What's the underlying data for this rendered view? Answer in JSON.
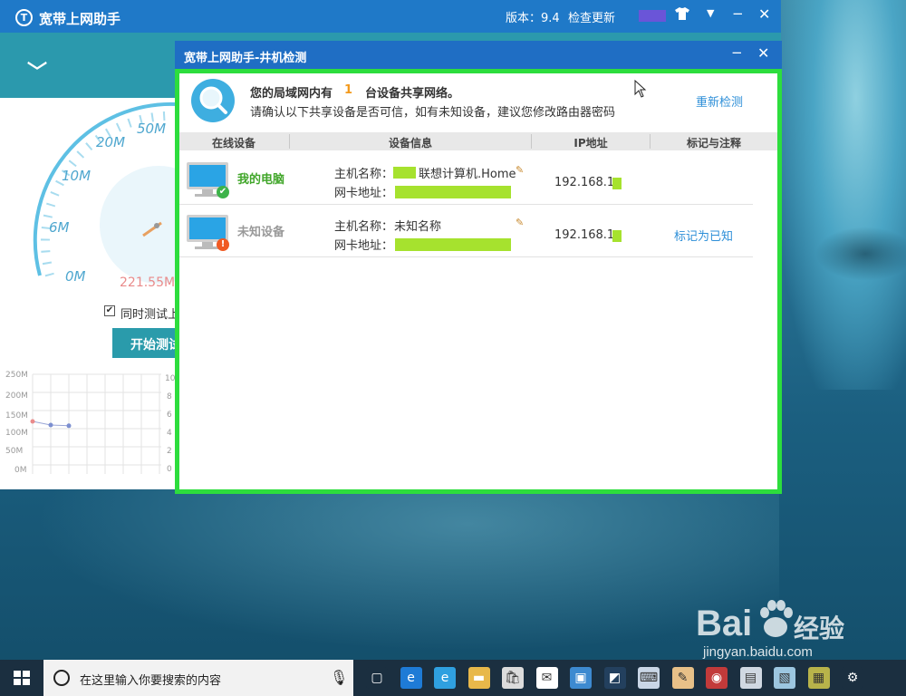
{
  "main_window": {
    "title": "宽带上网助手",
    "logo_glyph": "T",
    "version_text": "版本：9.4",
    "check_update": "检查更新",
    "skin_icon": "shirt-icon",
    "menu_icon": "menu-dropdown-icon",
    "minimize_glyph": "−",
    "close_glyph": "✕",
    "collapse_glyph": "﹀",
    "gauge": {
      "tick_labels": [
        "0M",
        "6M",
        "10M",
        "20M",
        "50M"
      ],
      "current_reading": "221.55M"
    },
    "sim_test": {
      "label": "同时测试上",
      "checked": true,
      "check_glyph": "✔"
    },
    "start_button": "开始测试",
    "history_chart": {
      "y_left": [
        "250M",
        "200M",
        "150M",
        "100M",
        "50M",
        "0M"
      ],
      "y_right": [
        "10",
        "8",
        "6",
        "4",
        "2",
        "0"
      ],
      "points": [
        120,
        110,
        108
      ]
    }
  },
  "dialog": {
    "title": "宽带上网助手-井机检测",
    "minimize_glyph": "−",
    "close_glyph": "✕",
    "summary": {
      "prefix": "您的局域网内有",
      "count": "1",
      "suffix": "台设备共享网络。",
      "advice": "请确认以下共享设备是否可信，如有未知设备，建议您修改路由器密码",
      "recheck": "重新检测"
    },
    "columns": [
      "在线设备",
      "设备信息",
      "IP地址",
      "标记与注释"
    ],
    "rows": [
      {
        "device": "我的电脑",
        "device_color": "#41a62a",
        "status": "ok",
        "status_glyph": "✔",
        "host_label": "主机名称：",
        "host_value": "联想计算机.Home",
        "mac_label": "网卡地址：",
        "ip": "192.168.1.",
        "mark": ""
      },
      {
        "device": "未知设备",
        "device_color": "#999999",
        "status": "warning",
        "status_glyph": "!",
        "host_label": "主机名称：",
        "host_value": "未知名称",
        "mac_label": "网卡地址：",
        "ip": "192.168.1.",
        "mark": "标记为已知"
      }
    ]
  },
  "watermark": {
    "brand": "Bai",
    "brand_suffix": "经验",
    "url": "jingyan.baidu.com"
  },
  "taskbar": {
    "search_placeholder": "在这里输入你要搜索的内容",
    "icons": [
      "task-view-icon",
      "edge-icon",
      "ie-icon",
      "file-explorer-icon",
      "store-icon",
      "mail-icon",
      "app-icon",
      "app-icon",
      "keyboard-icon",
      "paint-icon",
      "app-icon",
      "app-icon",
      "app-icon",
      "app-icon",
      "settings-icon"
    ]
  }
}
